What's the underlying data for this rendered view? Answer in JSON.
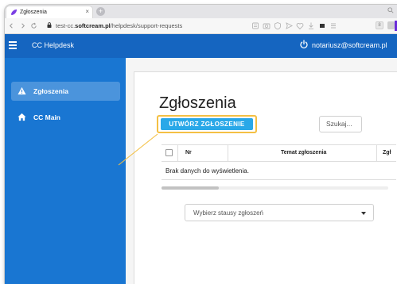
{
  "browser": {
    "tab_title": "Zgłoszenia",
    "tab_close_glyph": "×",
    "new_tab_glyph": "+",
    "url_prefix": "test-cc.",
    "url_domain": "softcream.pl",
    "url_path": "/helpdesk/support-requests",
    "ext_badge": "8",
    "toolbar_icons": [
      "reader-icon",
      "camera-icon",
      "shield-icon",
      "send-icon",
      "heart-icon",
      "download-icon",
      "battery-icon",
      "menu-icon"
    ]
  },
  "app": {
    "title": "CC Helpdesk",
    "user_email": "notariusz@softcream.pl",
    "brand_color": "#1565c0",
    "sidebar_color": "#1976d2"
  },
  "sidebar": {
    "items": [
      {
        "label": "Zgłoszenia",
        "icon": "warning-icon",
        "active": true
      },
      {
        "label": "CC Main",
        "icon": "home-icon",
        "active": false
      }
    ]
  },
  "main": {
    "page_title": "Zgłoszenia",
    "create_button_label": "UTWÓRZ ZGŁOSZENIE",
    "search_placeholder": "Szukaj...",
    "table": {
      "columns": [
        "Nr",
        "Temat zgłoszenia",
        "Zgł"
      ],
      "empty_message": "Brak danych do wyświetlenia."
    },
    "status_select": {
      "placeholder": "Wybierz stausy zgłoszeń"
    },
    "highlight_color": "#f4c043",
    "button_color": "#29a8e8"
  }
}
